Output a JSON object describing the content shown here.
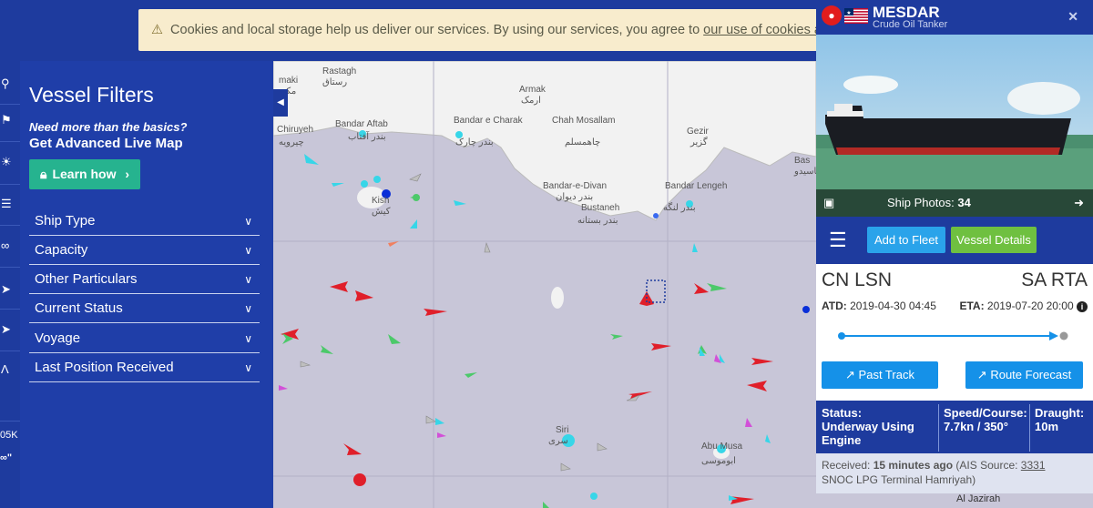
{
  "cookie_banner": {
    "text": "Cookies and local storage help us deliver our services. By using our services, you agree to",
    "link": "our use of cookies and local"
  },
  "iconbar": {
    "labels": [
      "05K",
      "∞\""
    ]
  },
  "filters": {
    "title": "Vessel Filters",
    "need_more": "Need more than the basics?",
    "advanced": "Get Advanced Live Map",
    "learn_how": "Learn how",
    "rows": [
      "Ship Type",
      "Capacity",
      "Other Particulars",
      "Current Status",
      "Voyage",
      "Last Position Received"
    ]
  },
  "map": {
    "labels": [
      {
        "en": "Rastagh",
        "fa": "رستاق"
      },
      {
        "en": "maki",
        "fa": "مکی"
      },
      {
        "en": "Armak",
        "fa": "ارمک"
      },
      {
        "en": "Bandar Aftab",
        "fa": "بندر آفتاب"
      },
      {
        "en": "Bandar e Charak",
        "fa": "بندر چارک"
      },
      {
        "en": "Chah Mosallam",
        "fa": "چاهمسلم"
      },
      {
        "en": "Gezir",
        "fa": "گزیر"
      },
      {
        "en": "Chiruyeh",
        "fa": "چیرویه"
      },
      {
        "en": "Kish",
        "fa": "کیش"
      },
      {
        "en": "Bandar-e-Divan",
        "fa": "بندر دیوان"
      },
      {
        "en": "Bustaneh",
        "fa": "بندر بستانه"
      },
      {
        "en": "Bandar Lengeh",
        "fa": "بندر لنگه"
      },
      {
        "en": "Siri",
        "fa": "سری"
      },
      {
        "en": "Abu Musa",
        "fa": "ابوموسی"
      },
      {
        "en": "Bas",
        "fa": "باسیدو"
      }
    ]
  },
  "vessel": {
    "name": "MESDAR",
    "type": "Crude Oil Tanker",
    "photo_caption": "Ship Photos:",
    "photo_count": "34",
    "add_to_fleet": "Add to Fleet",
    "details": "Vessel Details",
    "from": "CN LSN",
    "to": "SA RTA",
    "atd_label": "ATD:",
    "atd": "2019-04-30 04:45",
    "eta_label": "ETA:",
    "eta": "2019-07-20 20:00",
    "past_track": "Past Track",
    "route_forecast": "Route Forecast",
    "status_label": "Status:",
    "status": "Underway Using Engine",
    "speed_label": "Speed/Course:",
    "speed": "7.7kn / 350°",
    "draught_label": "Draught:",
    "draught": "10m",
    "received_label": "Received:",
    "received": "15 minutes ago",
    "ais_prefix": "(AIS Source:",
    "ais_link": "3331",
    "ais_rest": "SNOC LPG Terminal Hamriyah)",
    "map_bottom": "Al Jazirah"
  },
  "colors": {
    "header": "#1e3b9e",
    "filters_bg": "#1f3ea8",
    "learn_btn": "#26b38f",
    "fleet_btn": "#2aa3ea",
    "details_btn": "#6fc040",
    "track_btn": "#1591e8",
    "sea": "#c8c6d8",
    "land": "#f2f2f2"
  }
}
